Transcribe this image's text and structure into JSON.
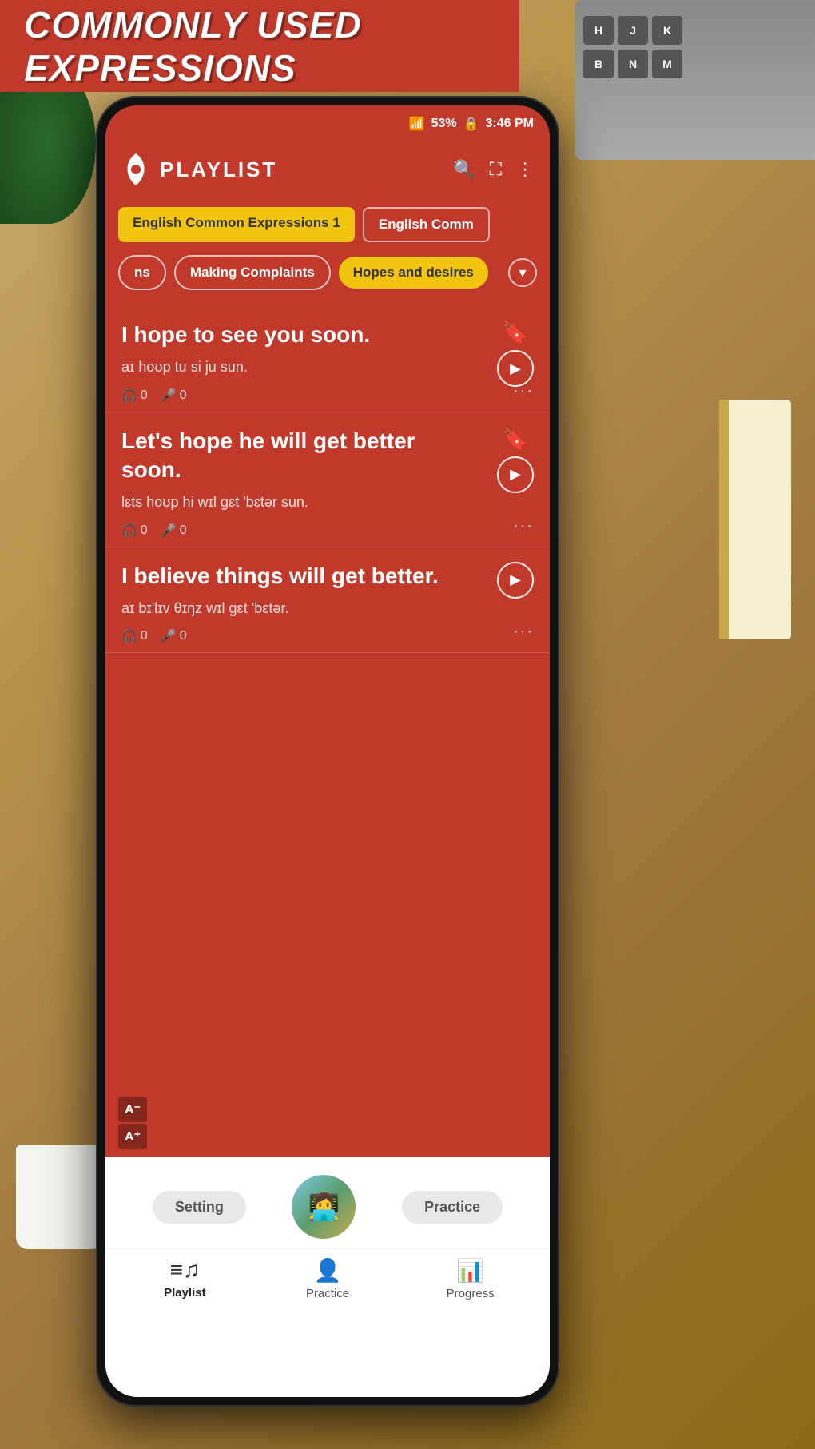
{
  "banner": {
    "text": "COMMONLY USED EXPRESSIONS"
  },
  "status_bar": {
    "signal": "53%",
    "lock": "🔒",
    "time": "3:46 PM"
  },
  "header": {
    "title": "PLAYLIST",
    "search_icon": "search",
    "fullscreen_icon": "fullscreen",
    "more_icon": "more-vertical"
  },
  "tabs_row1": [
    {
      "label": "English Common Expressions 1",
      "active": true
    },
    {
      "label": "English Comm",
      "active": false
    }
  ],
  "tabs_row2": [
    {
      "label": "ns",
      "active": false
    },
    {
      "label": "Making Complaints",
      "active": false
    },
    {
      "label": "Hopes and desires",
      "active": true
    }
  ],
  "phrases": [
    {
      "text": "I hope to see you soon.",
      "phonetic": "aɪ hoʊp tu si ju sun.",
      "listen_count": "0",
      "speak_count": "0",
      "bookmarked": true,
      "has_play": true
    },
    {
      "text": "Let's hope he will get better soon.",
      "phonetic": "lɛts hoʊp hi wɪl gɛt 'bɛtər sun.",
      "listen_count": "0",
      "speak_count": "0",
      "bookmarked": true,
      "has_play": true
    },
    {
      "text": "I believe things will get better.",
      "phonetic": "aɪ bɪ'lɪv θɪŋz wɪl gɛt 'bɛtər.",
      "listen_count": "0",
      "speak_count": "0",
      "bookmarked": false,
      "has_play": true
    }
  ],
  "font_controls": {
    "decrease": "A⁻",
    "increase": "A⁺"
  },
  "player": {
    "setting_label": "Setting",
    "practice_label": "Practice"
  },
  "nav_items": [
    {
      "label": "Playlist",
      "active": true,
      "icon": "playlist"
    },
    {
      "label": "Practice",
      "active": false,
      "icon": "practice"
    },
    {
      "label": "Progress",
      "active": false,
      "icon": "progress"
    }
  ],
  "colors": {
    "red": "#c0392b",
    "yellow": "#f1c40f",
    "white": "#ffffff"
  }
}
